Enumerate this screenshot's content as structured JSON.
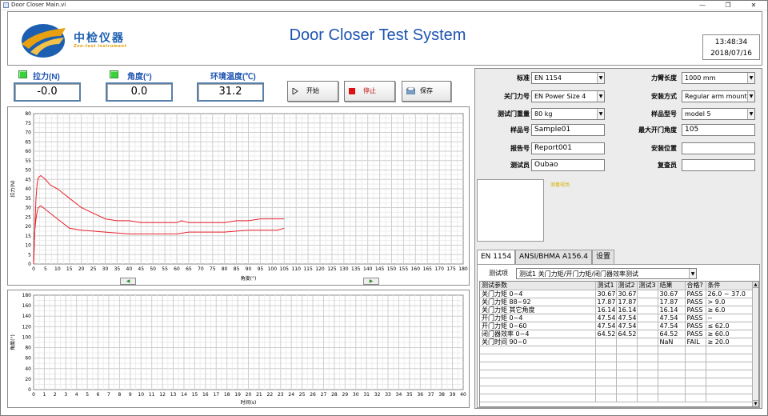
{
  "window": {
    "title": "Door Closer Main.vi",
    "minimize": "—",
    "restore": "❐",
    "close": "✕"
  },
  "logo": {
    "name": "中检仪器",
    "sub": "Zon-test instrument",
    "colors": {
      "blue": "#1c5fb0",
      "orange": "#e8a010"
    }
  },
  "app_title": "Door Closer Test System",
  "clock": {
    "time": "13:48:34",
    "date": "2018/07/16"
  },
  "indicators": [
    {
      "label": "拉力(N)",
      "value": "-0.0",
      "led": true
    },
    {
      "label": "角度(°)",
      "value": "0.0",
      "led": true
    },
    {
      "label": "环境温度(℃)",
      "value": "31.2",
      "led": false
    }
  ],
  "buttons": {
    "start": "开始",
    "stop": "停止",
    "save": "保存"
  },
  "chart_data": [
    {
      "type": "line",
      "xlabel": "角度(°)",
      "ylabel": "拉力(N)",
      "xlim": [
        0,
        180
      ],
      "ylim": [
        0,
        80
      ],
      "xticks": [
        0,
        5,
        10,
        15,
        20,
        25,
        30,
        35,
        40,
        45,
        50,
        55,
        60,
        65,
        70,
        75,
        80,
        85,
        90,
        95,
        100,
        105,
        110,
        115,
        120,
        125,
        130,
        135,
        140,
        145,
        150,
        155,
        160,
        165,
        170,
        175,
        180
      ],
      "yticks": [
        0,
        5,
        10,
        15,
        20,
        25,
        30,
        35,
        40,
        45,
        50,
        55,
        60,
        65,
        70,
        75,
        80
      ],
      "grid": true,
      "color": "#e8202a",
      "series": [
        {
          "x": [
            0,
            0.5,
            1,
            1.5,
            2,
            3,
            5,
            7,
            10,
            15,
            20,
            25,
            30,
            35,
            40,
            45,
            50,
            55,
            60,
            62,
            65,
            70,
            75,
            80,
            85,
            90,
            95,
            100,
            105
          ],
          "y": [
            0,
            18,
            35,
            43,
            46,
            47,
            45,
            42,
            40,
            35,
            30,
            27,
            24,
            23,
            23,
            22,
            22,
            22,
            22,
            23,
            22,
            22,
            22,
            22,
            23,
            23,
            24,
            24,
            24
          ]
        },
        {
          "x": [
            105,
            102,
            100,
            95,
            90,
            85,
            80,
            75,
            70,
            65,
            60,
            55,
            50,
            45,
            40,
            35,
            30,
            25,
            20,
            15,
            10,
            7,
            5,
            3,
            2,
            1.5,
            1,
            0.5,
            0
          ],
          "y": [
            19,
            18,
            18,
            18,
            18,
            17.5,
            17,
            17,
            17,
            17,
            16,
            16,
            16,
            16,
            16,
            16.5,
            17,
            17.5,
            18,
            19,
            24,
            27,
            29,
            31,
            30,
            28,
            24,
            18,
            0
          ]
        }
      ],
      "nav_left": "◀",
      "nav_right": "▶"
    },
    {
      "type": "line",
      "xlabel": "时间(s)",
      "ylabel": "角度(°)",
      "xlim": [
        0,
        40
      ],
      "ylim": [
        0,
        180
      ],
      "xticks": [
        0,
        1,
        2,
        3,
        4,
        5,
        6,
        7,
        8,
        9,
        10,
        11,
        12,
        13,
        14,
        15,
        16,
        17,
        18,
        19,
        20,
        21,
        22,
        23,
        24,
        25,
        26,
        27,
        28,
        29,
        30,
        31,
        32,
        33,
        34,
        35,
        36,
        37,
        38,
        39,
        40
      ],
      "yticks": [
        0,
        20,
        40,
        60,
        80,
        100,
        120,
        140,
        160,
        180
      ],
      "grid": true,
      "series": []
    }
  ],
  "form": {
    "left": [
      {
        "label": "标准",
        "value": "EN 1154",
        "type": "select"
      },
      {
        "label": "关门力号",
        "value": "EN Power Size 4",
        "type": "select"
      },
      {
        "label": "测试门重量",
        "value": "80 kg",
        "type": "select"
      },
      {
        "label": "样品号",
        "value": "Sample01",
        "type": "input"
      },
      {
        "label": "报告号",
        "value": "Report001",
        "type": "input"
      },
      {
        "label": "测试员",
        "value": "Oubao",
        "type": "input"
      }
    ],
    "right": [
      {
        "label": "力臂长度",
        "value": "1000 mm",
        "type": "select"
      },
      {
        "label": "安装方式",
        "value": "Regular arm mounted",
        "type": "select"
      },
      {
        "label": "样品型号",
        "value": "model 5",
        "type": "select"
      },
      {
        "label": "最大开门角度",
        "value": "105",
        "type": "input"
      },
      {
        "label": "安装位置",
        "value": "",
        "type": "input"
      },
      {
        "label": "复查员",
        "value": "",
        "type": "input"
      }
    ]
  },
  "image_label": "测量视场",
  "tabs": [
    "EN 1154",
    "ANSI/BHMA A156.4",
    "设置"
  ],
  "test_item": {
    "label": "测试项",
    "value": "测试1 关门力矩/开门力矩/闭门器效率测试"
  },
  "results": {
    "headers": [
      "测试参数",
      "测试1",
      "测试2",
      "测试3",
      "结果",
      "合格?",
      "条件"
    ],
    "rows": [
      [
        "关门力矩 0~4",
        "30.67",
        "30.67",
        "",
        "30.67",
        "PASS",
        "26.0 ~ 37.0"
      ],
      [
        "关门力矩 88~92",
        "17.87",
        "17.87",
        "",
        "17.87",
        "PASS",
        "> 9.0"
      ],
      [
        "关门力矩 其它角度",
        "16.14",
        "16.14",
        "",
        "16.14",
        "PASS",
        "≥ 6.0"
      ],
      [
        "开门力矩 0~4",
        "47.54",
        "47.54",
        "",
        "47.54",
        "PASS",
        "--"
      ],
      [
        "开门力矩 0~60",
        "47.54",
        "47.54",
        "",
        "47.54",
        "PASS",
        "≤ 62.0"
      ],
      [
        "闭门器效率 0~4",
        "64.52",
        "64.52",
        "",
        "64.52",
        "PASS",
        "≥ 60.0"
      ],
      [
        "关门时间 90~0",
        "",
        "",
        "",
        "NaN",
        "FAIL",
        "≥ 20.0"
      ]
    ],
    "empty_rows": 7
  },
  "scroll": {
    "up": "▲",
    "down": "▼"
  }
}
